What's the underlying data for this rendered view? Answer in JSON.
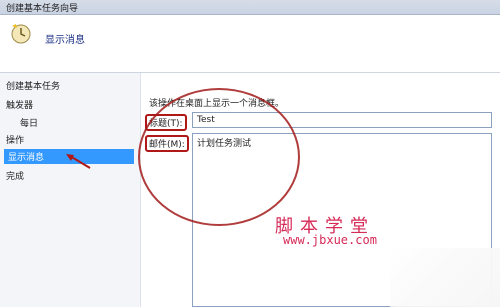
{
  "window": {
    "title": "创建基本任务向导"
  },
  "header": {
    "page_title": "显示消息",
    "icon": "task-wizard-icon"
  },
  "nav": {
    "items": [
      {
        "label": "创建基本任务"
      },
      {
        "label": "触发器"
      },
      {
        "label": "每日"
      },
      {
        "label": "操作"
      },
      {
        "label": "显示消息",
        "selected": true
      },
      {
        "label": "完成"
      }
    ]
  },
  "content": {
    "instruction": "该操作在桌面上显示一个消息框。",
    "title_label": "标题(T):",
    "title_value": "Test",
    "message_label": "邮件(M):",
    "message_value": "计划任务测试"
  },
  "watermark": {
    "line1": "脚本学堂",
    "line2": "www.jbxue.com"
  },
  "colors": {
    "accent_select": "#3399ff",
    "annotation": "#a21a1a",
    "watermark": "#d62a57"
  }
}
